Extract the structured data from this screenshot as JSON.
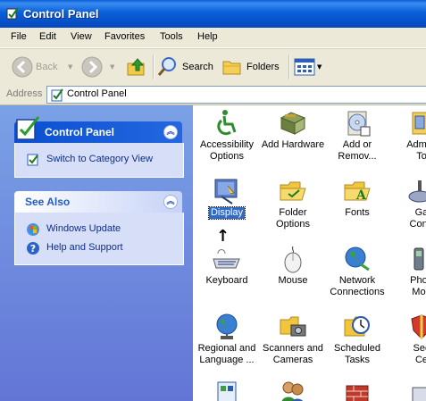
{
  "window": {
    "title": "Control Panel"
  },
  "menubar": {
    "items": [
      "File",
      "Edit",
      "View",
      "Favorites",
      "Tools",
      "Help"
    ]
  },
  "toolbar": {
    "back_label": "Back",
    "search_label": "Search",
    "folders_label": "Folders"
  },
  "address": {
    "label": "Address",
    "value": "Control Panel"
  },
  "taskpane": {
    "control_panel_title": "Control Panel",
    "switch_link": "Switch to Category View",
    "see_also_title": "See Also",
    "see_also_links": [
      "Windows Update",
      "Help and Support"
    ]
  },
  "items": [
    {
      "label": "Accessibility\nOptions",
      "icon": "accessibility-icon"
    },
    {
      "label": "Add Hardware",
      "icon": "add-hardware-icon"
    },
    {
      "label": "Add or\nRemov...",
      "icon": "add-remove-programs-icon"
    },
    {
      "label": "Admini\nTo",
      "icon": "administrative-tools-icon"
    },
    {
      "label": "Display",
      "icon": "display-icon",
      "selected": true
    },
    {
      "label": "Folder Options",
      "icon": "folder-options-icon"
    },
    {
      "label": "Fonts",
      "icon": "fonts-icon"
    },
    {
      "label": "Ga\nContr",
      "icon": "game-controllers-icon"
    },
    {
      "label": "Keyboard",
      "icon": "keyboard-icon"
    },
    {
      "label": "Mouse",
      "icon": "mouse-icon"
    },
    {
      "label": "Network\nConnections",
      "icon": "network-connections-icon"
    },
    {
      "label": "Phon\nMod",
      "icon": "phone-modem-icon"
    },
    {
      "label": "Regional and\nLanguage ...",
      "icon": "regional-language-icon"
    },
    {
      "label": "Scanners and\nCameras",
      "icon": "scanners-cameras-icon"
    },
    {
      "label": "Scheduled\nTasks",
      "icon": "scheduled-tasks-icon"
    },
    {
      "label": "Sec\nCe",
      "icon": "security-center-icon"
    }
  ],
  "colors": {
    "titlebar": "#0a5fd9",
    "taskpane": "#6f8bdc",
    "selection": "#316ac5"
  }
}
